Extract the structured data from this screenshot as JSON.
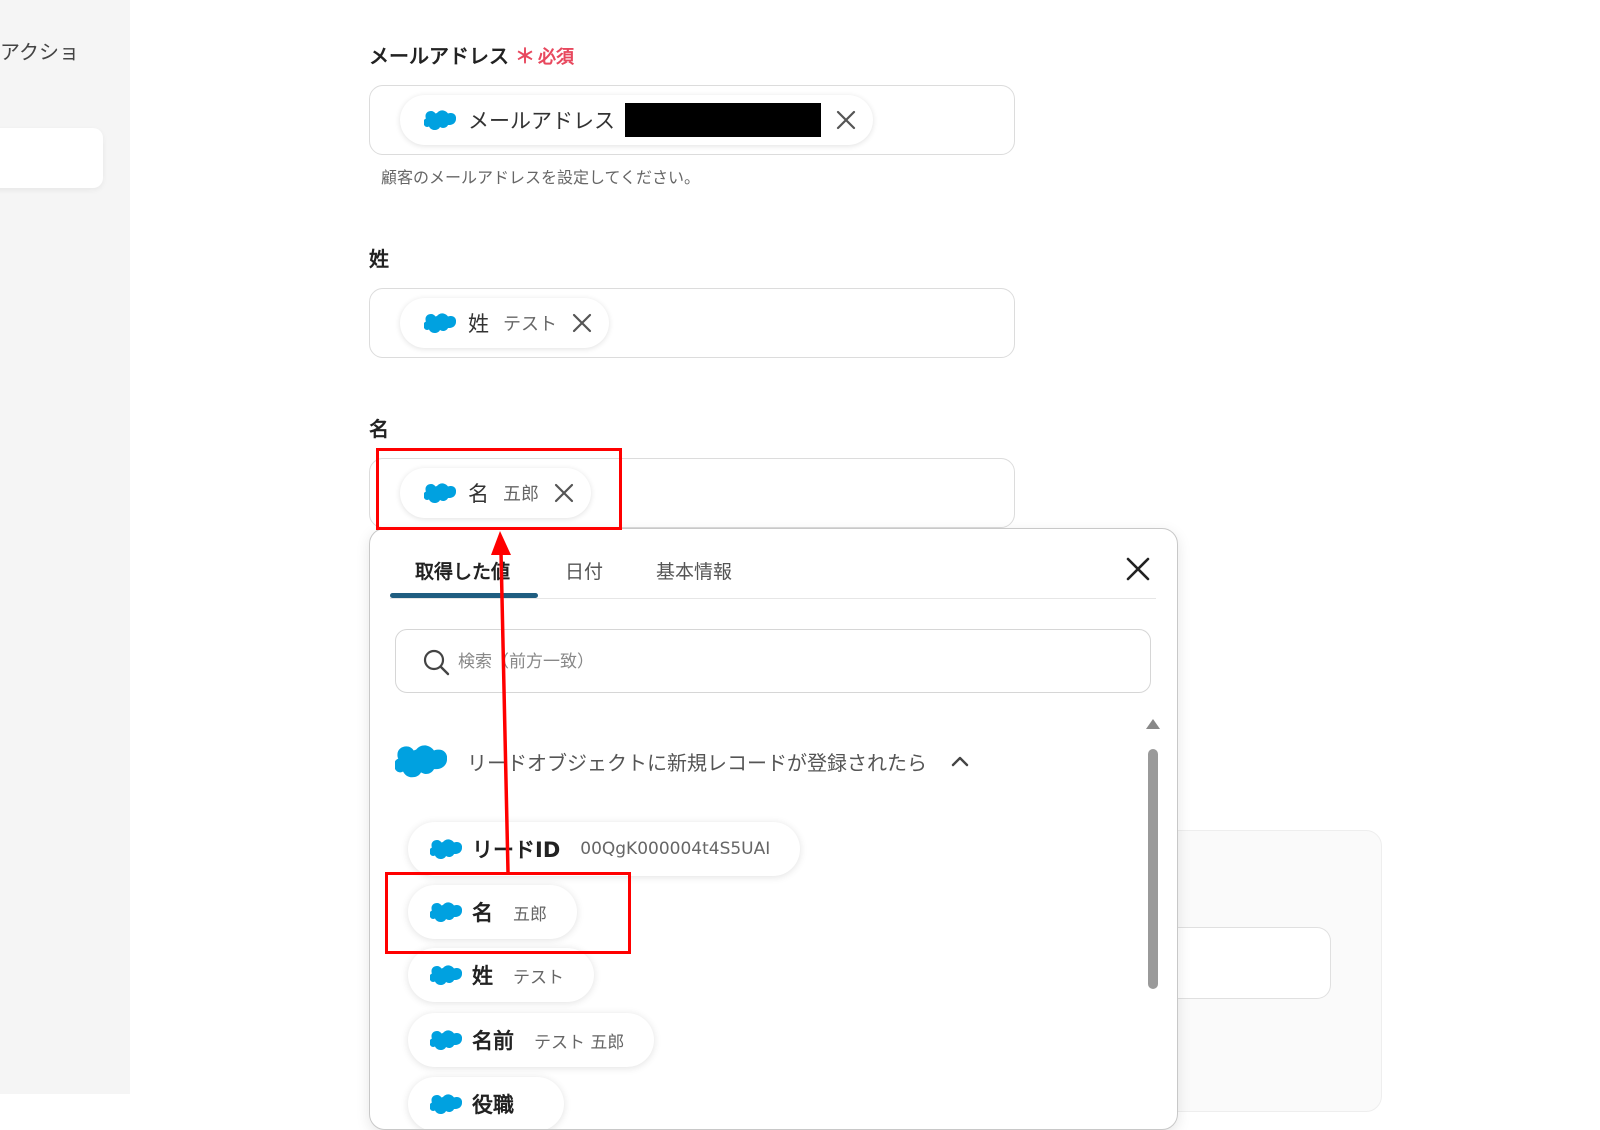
{
  "sidebar": {
    "partial_text": "アクショ"
  },
  "email_field": {
    "label": "メールアドレス",
    "required_star": "＊",
    "required_text": "必須",
    "chip_label": "メールアドレス",
    "hint": "顧客のメールアドレスを設定してください。"
  },
  "last_name_field": {
    "label": "姓",
    "chip_label": "姓",
    "chip_value": "テスト"
  },
  "first_name_field": {
    "label": "名",
    "chip_label": "名",
    "chip_value": "五郎"
  },
  "popup": {
    "tabs": [
      {
        "label": "取得した値",
        "active": true
      },
      {
        "label": "日付",
        "active": false
      },
      {
        "label": "基本情報",
        "active": false
      }
    ],
    "search_placeholder": "検索（前方一致）",
    "group_title": "リードオブジェクトに新規レコードが登録されたら",
    "items": [
      {
        "label": "リードID",
        "value": "00QgK000004t4S5UAI"
      },
      {
        "label": "名",
        "value": "五郎"
      },
      {
        "label": "姓",
        "value": "テスト"
      },
      {
        "label": "名前",
        "value": "テスト 五郎"
      },
      {
        "label": "役職",
        "value": ""
      }
    ]
  },
  "colors": {
    "salesforce_blue": "#00a1e0",
    "required_red": "#e8485e",
    "tab_underline": "#1f5d80",
    "annotation_red": "#ff0000"
  },
  "icons": [
    "salesforce-cloud-icon",
    "close-icon",
    "search-icon",
    "chevron-up-icon"
  ]
}
